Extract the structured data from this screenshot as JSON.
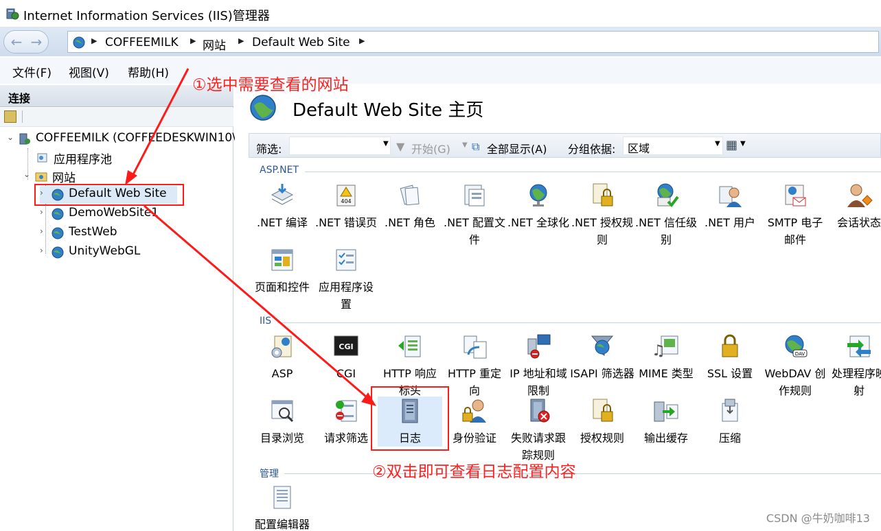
{
  "window": {
    "title": "Internet Information Services (IIS)管理器"
  },
  "address": {
    "crumbs": [
      "COFFEEMILK",
      "网站",
      "Default Web Site"
    ]
  },
  "menu": {
    "file": "文件(F)",
    "view": "视图(V)",
    "help": "帮助(H)"
  },
  "left_pane": {
    "header": "连接",
    "tree": {
      "server": "COFFEEMILK (COFFEEDESKWIN10\\",
      "app_pools": "应用程序池",
      "sites": "网站",
      "site_items": [
        "Default Web Site",
        "DemoWebSite1",
        "TestWeb",
        "UnityWebGL"
      ]
    }
  },
  "main": {
    "title": "Default Web Site 主页",
    "filter": {
      "label": "筛选:",
      "start": "开始(G)",
      "show_all": "全部显示(A)",
      "group_by_label": "分组依据:",
      "group_by_value": "区域"
    },
    "sections": {
      "aspnet": {
        "title": "ASP.NET",
        "items": [
          {
            "label": ".NET 编译",
            "icon": "dotnet-compilation-icon"
          },
          {
            "label": ".NET 错误页",
            "icon": "dotnet-error-pages-icon"
          },
          {
            "label": ".NET 角色",
            "icon": "dotnet-roles-icon"
          },
          {
            "label": ".NET 配置文件",
            "icon": "dotnet-profile-icon"
          },
          {
            "label": ".NET 全球化",
            "icon": "dotnet-globalization-icon"
          },
          {
            "label": ".NET 授权规则",
            "icon": "dotnet-authorization-icon"
          },
          {
            "label": ".NET 信任级别",
            "icon": "dotnet-trust-icon"
          },
          {
            "label": ".NET 用户",
            "icon": "dotnet-users-icon"
          },
          {
            "label": "SMTP 电子邮件",
            "icon": "smtp-icon"
          },
          {
            "label": "会话状态",
            "icon": "session-state-icon"
          },
          {
            "label": "页面和控件",
            "icon": "pages-controls-icon"
          },
          {
            "label": "应用程序设置",
            "icon": "app-settings-icon"
          }
        ]
      },
      "iis": {
        "title": "IIS",
        "items": [
          {
            "label": "ASP",
            "icon": "asp-icon"
          },
          {
            "label": "CGI",
            "icon": "cgi-icon"
          },
          {
            "label": "HTTP 响应标头",
            "icon": "http-headers-icon"
          },
          {
            "label": "HTTP 重定向",
            "icon": "http-redirect-icon"
          },
          {
            "label": "IP 地址和域限制",
            "icon": "ip-restrictions-icon"
          },
          {
            "label": "ISAPI 筛选器",
            "icon": "isapi-filters-icon"
          },
          {
            "label": "MIME 类型",
            "icon": "mime-types-icon"
          },
          {
            "label": "SSL 设置",
            "icon": "ssl-settings-icon"
          },
          {
            "label": "WebDAV 创作规则",
            "icon": "webdav-icon"
          },
          {
            "label": "处理程序映射",
            "icon": "handler-mappings-icon"
          },
          {
            "label": "目录浏览",
            "icon": "directory-browsing-icon"
          },
          {
            "label": "请求筛选",
            "icon": "request-filtering-icon"
          },
          {
            "label": "日志",
            "icon": "logging-icon"
          },
          {
            "label": "身份验证",
            "icon": "authentication-icon"
          },
          {
            "label": "失败请求跟踪规则",
            "icon": "failed-request-tracing-icon"
          },
          {
            "label": "授权规则",
            "icon": "authorization-rules-icon"
          },
          {
            "label": "输出缓存",
            "icon": "output-caching-icon"
          },
          {
            "label": "压缩",
            "icon": "compression-icon"
          }
        ]
      },
      "management": {
        "title": "管理",
        "items": [
          {
            "label": "配置编辑器",
            "icon": "config-editor-icon"
          }
        ]
      }
    }
  },
  "annotations": {
    "step1": "①选中需要查看的网站",
    "step2": "②双击即可查看日志配置内容",
    "watermark": "CSDN @牛奶咖啡13",
    "color": "#ff1a1a"
  }
}
